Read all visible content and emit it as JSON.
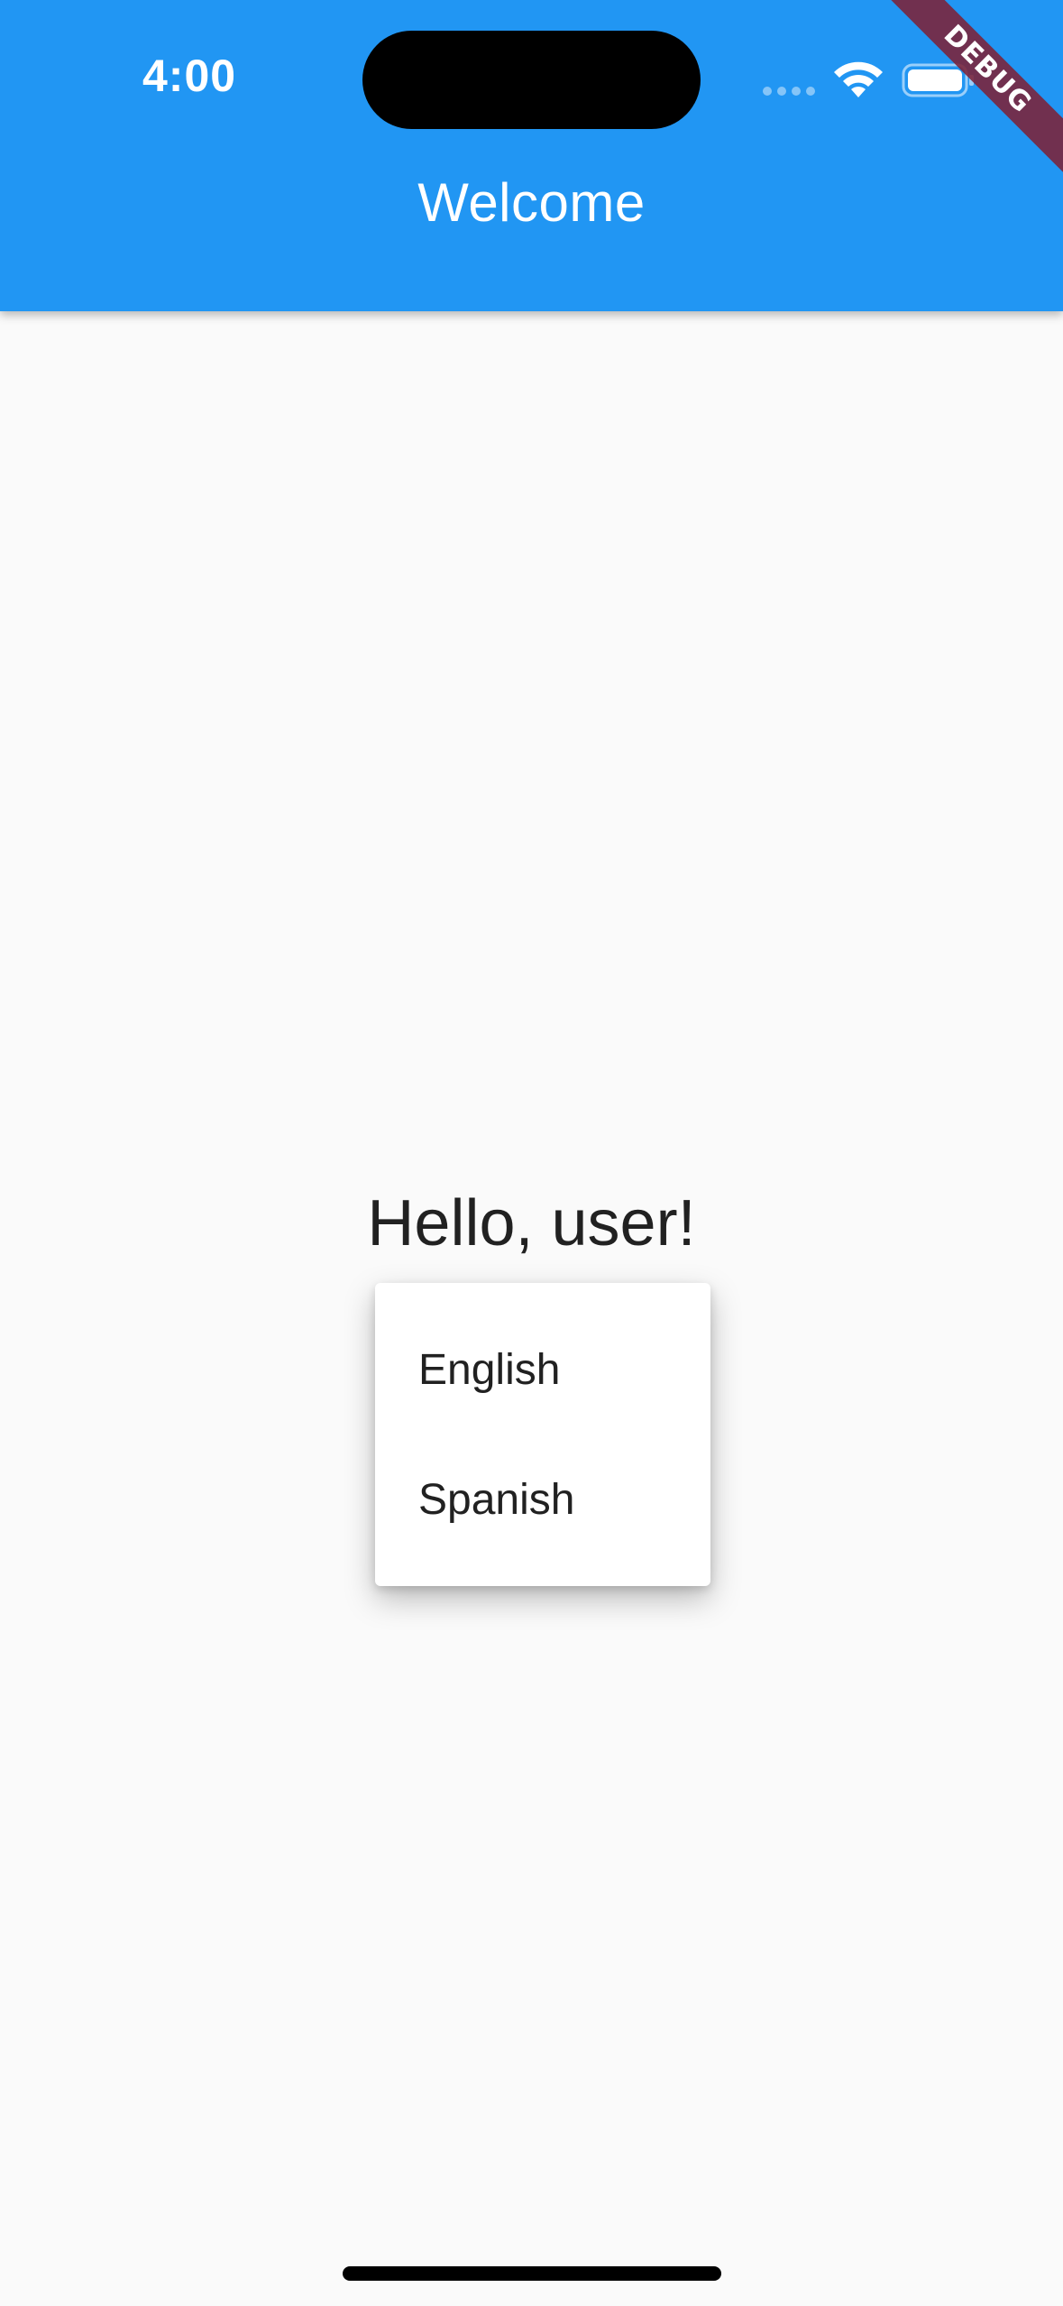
{
  "status_bar": {
    "time": "4:00",
    "wifi_icon": "wifi-icon",
    "battery_icon": "battery-icon",
    "signal_icon": "cellular-signal-icon"
  },
  "app_bar": {
    "title": "Welcome",
    "background_color": "#2196f3"
  },
  "debug_banner": {
    "label": "DEBUG",
    "color": "#7c2238"
  },
  "main": {
    "greeting": "Hello, user!"
  },
  "language_menu": {
    "items": [
      {
        "label": "English"
      },
      {
        "label": "Spanish"
      }
    ]
  }
}
